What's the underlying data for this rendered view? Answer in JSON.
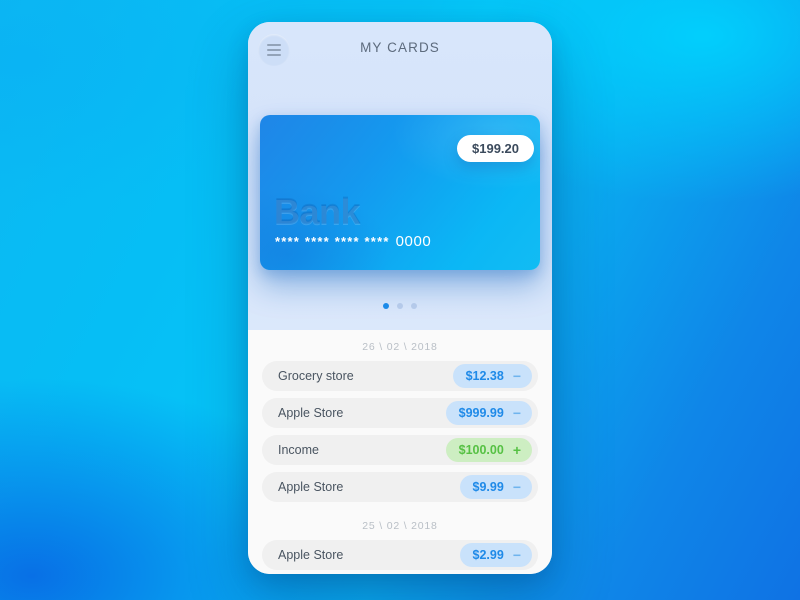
{
  "background": {
    "gradient_from": "#0cb8f2",
    "gradient_to": "#0f72e4"
  },
  "header": {
    "title": "MY CARDS",
    "menu_icon": "hamburger-menu-icon"
  },
  "card": {
    "bank_name": "Bank",
    "number_mask": "**** **** **** ****",
    "last_four": "0000",
    "balance": "$199.20",
    "gradient_from": "#1f86e8",
    "gradient_to": "#12bcf3"
  },
  "carousel": {
    "dots": [
      {
        "active": true
      },
      {
        "active": false
      },
      {
        "active": false
      }
    ]
  },
  "transactions": {
    "groups": [
      {
        "date": "26 \\ 02 \\ 2018",
        "items": [
          {
            "name": "Grocery store",
            "amount": "$12.38",
            "sign": "−",
            "type": "debit"
          },
          {
            "name": "Apple Store",
            "amount": "$999.99",
            "sign": "−",
            "type": "debit"
          },
          {
            "name": "Income",
            "amount": "$100.00",
            "sign": "+",
            "type": "credit"
          },
          {
            "name": "Apple Store",
            "amount": "$9.99",
            "sign": "−",
            "type": "debit"
          }
        ]
      },
      {
        "date": "25 \\ 02 \\ 2018",
        "items": [
          {
            "name": "Apple Store",
            "amount": "$2.99",
            "sign": "−",
            "type": "debit"
          }
        ]
      }
    ],
    "colors": {
      "debit_bg": "#c9e2fb",
      "debit_text": "#1f8ae8",
      "credit_bg": "#cdeec2",
      "credit_text": "#56c144"
    }
  }
}
